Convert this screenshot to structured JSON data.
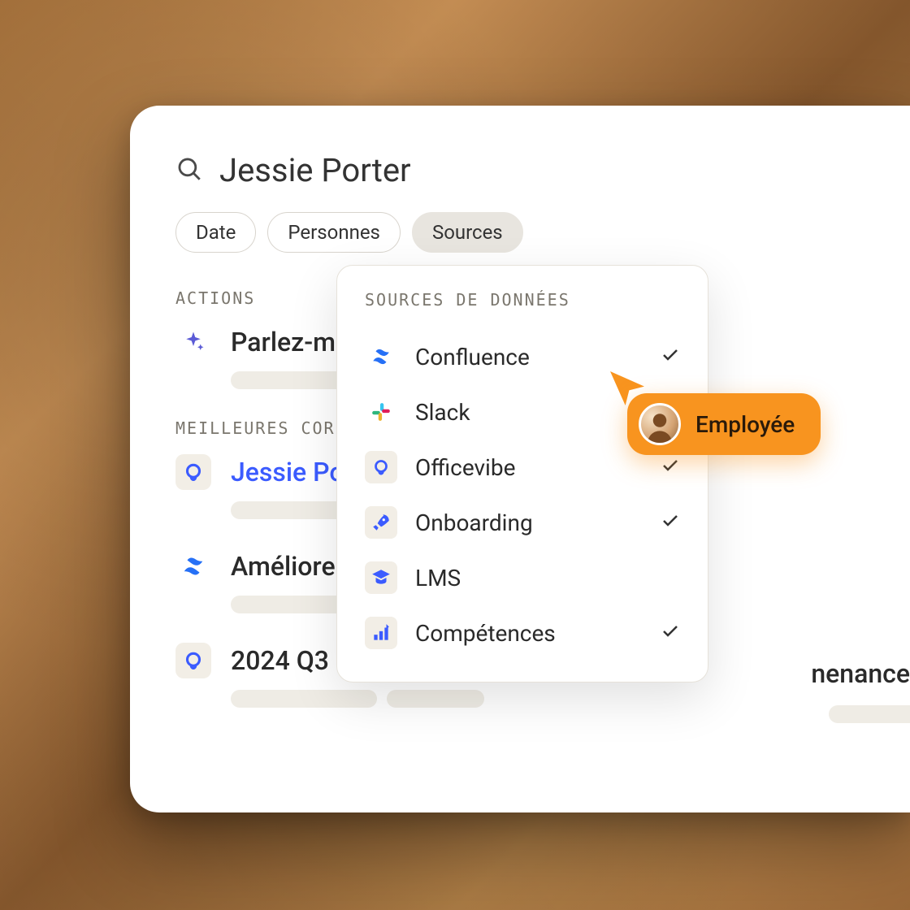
{
  "search": {
    "query": "Jessie Porter"
  },
  "filters": {
    "date": "Date",
    "people": "Personnes",
    "sources": "Sources"
  },
  "sections": {
    "actions": "ACTIONS",
    "best_matches": "MEILLEURES CORR"
  },
  "action_row": {
    "title": "Parlez-m"
  },
  "results": [
    {
      "title": "Jessie Po",
      "icon": "officevibe"
    },
    {
      "title": "Améliorer",
      "icon": "confluence",
      "rightText": "nenance"
    },
    {
      "title": "2024 Q3",
      "icon": "officevibe"
    }
  ],
  "dropdown": {
    "title": "SOURCES DE DONNÉES",
    "items": [
      {
        "label": "Confluence",
        "icon": "confluence",
        "checked": true
      },
      {
        "label": "Slack",
        "icon": "slack",
        "checked": false
      },
      {
        "label": "Officevibe",
        "icon": "officevibe",
        "checked": true
      },
      {
        "label": "Onboarding",
        "icon": "onboarding",
        "checked": true
      },
      {
        "label": "LMS",
        "icon": "lms",
        "checked": false
      },
      {
        "label": "Compétences",
        "icon": "competences",
        "checked": true
      }
    ]
  },
  "cursor_pill": {
    "label": "Employée"
  }
}
